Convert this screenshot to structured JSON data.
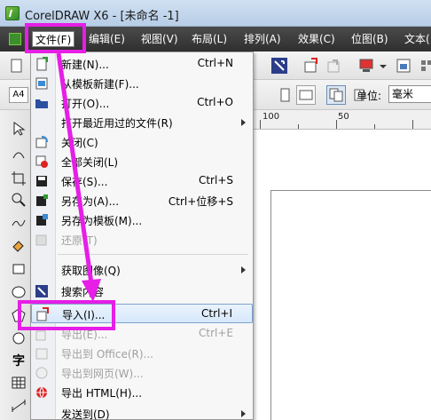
{
  "window": {
    "title": "CorelDRAW X6 - [未命名 -1]"
  },
  "menubar": {
    "items": [
      "文件(F)",
      "编辑(E)",
      "视图(V)",
      "布局(L)",
      "排列(A)",
      "效果(C)",
      "位图(B)",
      "文本("
    ]
  },
  "toolbar": {
    "doc_size": "A4",
    "unit_label": "单位:",
    "unit_value": "毫米"
  },
  "ruler": {
    "labels": [
      "100",
      "50"
    ]
  },
  "file_menu": {
    "items": [
      {
        "label": "新建(N)...",
        "shortcut": "Ctrl+N",
        "icon": "new-doc-icon"
      },
      {
        "label": "从模板新建(F)...",
        "shortcut": "",
        "icon": "template-icon"
      },
      {
        "label": "打开(O)...",
        "shortcut": "Ctrl+O",
        "icon": "open-folder-icon"
      },
      {
        "label": "打开最近用过的文件(R)",
        "shortcut": "",
        "icon": ""
      },
      {
        "label": "关闭(C)",
        "shortcut": "",
        "icon": "close-doc-icon"
      },
      {
        "label": "全部关闭(L)",
        "shortcut": "",
        "icon": "close-all-icon"
      },
      {
        "label": "保存(S)...",
        "shortcut": "Ctrl+S",
        "icon": "save-icon"
      },
      {
        "label": "另存为(A)...",
        "shortcut": "Ctrl+位移+S",
        "icon": "save-as-icon"
      },
      {
        "label": "另存为模板(M)...",
        "shortcut": "",
        "icon": "save-template-icon"
      },
      {
        "label": "还原(T)",
        "shortcut": "",
        "icon": "revert-icon"
      },
      {
        "label": "获取图像(Q)",
        "shortcut": "",
        "icon": ""
      },
      {
        "label": "搜索内容",
        "shortcut": "",
        "icon": "search-content-icon"
      },
      {
        "label": "导入(I)...",
        "shortcut": "Ctrl+I",
        "icon": "import-icon"
      },
      {
        "label": "导出(E)...",
        "shortcut": "Ctrl+E",
        "icon": "export-icon"
      },
      {
        "label": "导出到 Office(R)...",
        "shortcut": "",
        "icon": "export-office-icon"
      },
      {
        "label": "导出到网页(W)...",
        "shortcut": "",
        "icon": "export-web-icon"
      },
      {
        "label": "导出 HTML(H)...",
        "shortcut": "",
        "icon": "export-html-icon"
      },
      {
        "label": "发送到(D)",
        "shortcut": "",
        "icon": ""
      }
    ]
  },
  "colors": {
    "annotation": "#e61ee6",
    "menubar_bg": "#3a3a3a",
    "highlight_border": "#7da2ce"
  }
}
